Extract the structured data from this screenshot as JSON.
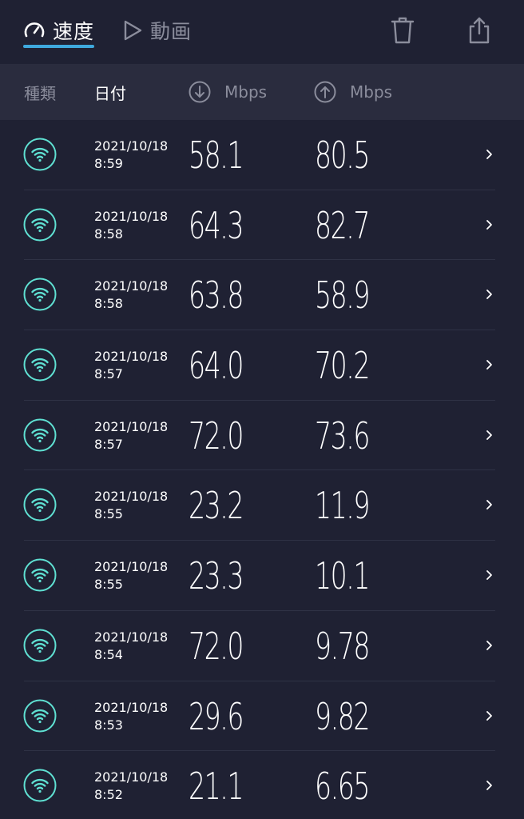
{
  "tabs": {
    "speed_label": "速度",
    "video_label": "動画"
  },
  "header": {
    "type": "種類",
    "date": "日付",
    "download_unit": "Mbps",
    "upload_unit": "Mbps"
  },
  "colors": {
    "accent": "#3fa9de",
    "wifi": "#5fe0d2",
    "background": "#1f2133",
    "header_bg": "#2a2c3e"
  },
  "rows": [
    {
      "date": "2021/10/18",
      "time": "8:59",
      "download": "58.1",
      "upload": "80.5"
    },
    {
      "date": "2021/10/18",
      "time": "8:58",
      "download": "64.3",
      "upload": "82.7"
    },
    {
      "date": "2021/10/18",
      "time": "8:58",
      "download": "63.8",
      "upload": "58.9"
    },
    {
      "date": "2021/10/18",
      "time": "8:57",
      "download": "64.0",
      "upload": "70.2"
    },
    {
      "date": "2021/10/18",
      "time": "8:57",
      "download": "72.0",
      "upload": "73.6"
    },
    {
      "date": "2021/10/18",
      "time": "8:55",
      "download": "23.2",
      "upload": "11.9"
    },
    {
      "date": "2021/10/18",
      "time": "8:55",
      "download": "23.3",
      "upload": "10.1"
    },
    {
      "date": "2021/10/18",
      "time": "8:54",
      "download": "72.0",
      "upload": "9.78"
    },
    {
      "date": "2021/10/18",
      "time": "8:53",
      "download": "29.6",
      "upload": "9.82"
    },
    {
      "date": "2021/10/18",
      "time": "8:52",
      "download": "21.1",
      "upload": "6.65"
    }
  ]
}
